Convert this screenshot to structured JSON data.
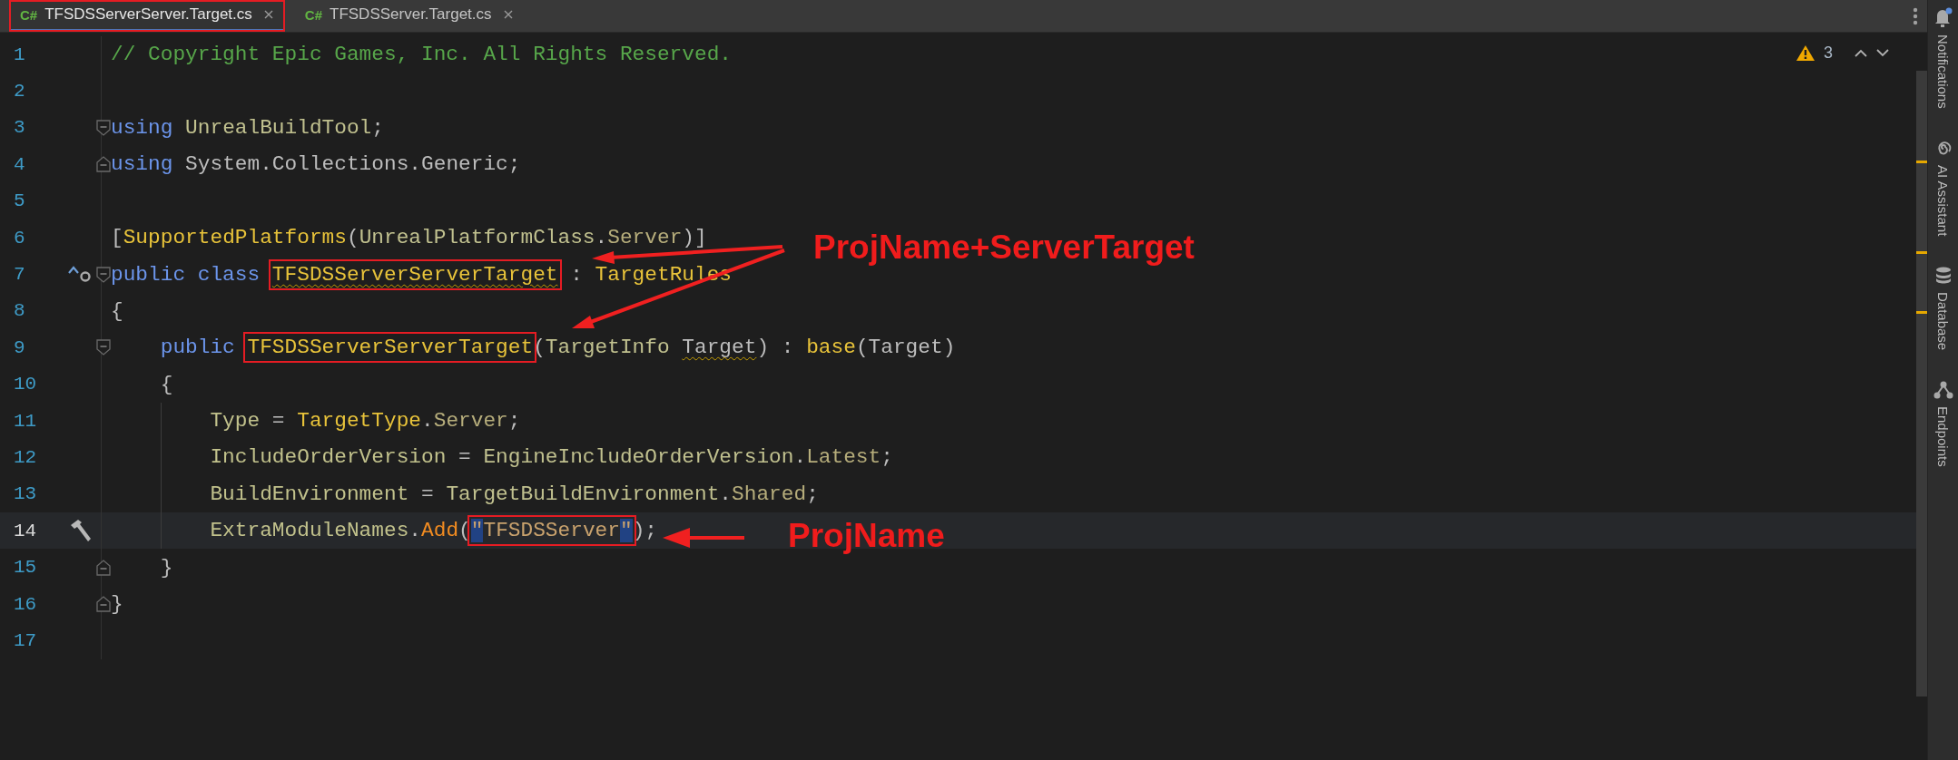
{
  "tabs": [
    {
      "lang": "C#",
      "label": "TFSDSServerServer.Target.cs",
      "selected": true,
      "boxed": true
    },
    {
      "lang": "C#",
      "label": "TFSDSServer.Target.cs",
      "selected": false,
      "boxed": false
    }
  ],
  "editor": {
    "warning_count": "3",
    "lines": [
      {
        "number": "1",
        "current": false,
        "tokens": [
          {
            "kind": "comment",
            "text": "// Copyright Epic Games, Inc. All Rights Reserved."
          }
        ]
      },
      {
        "number": "2",
        "current": false
      },
      {
        "number": "3",
        "current": false,
        "fold": {
          "kind": "open"
        },
        "tokens": [
          {
            "kind": "kw",
            "text": "using "
          },
          {
            "kind": "type",
            "text": "UnrealBuildTool"
          },
          {
            "kind": "plain",
            "text": ";"
          }
        ]
      },
      {
        "number": "4",
        "current": false,
        "fold": {
          "kind": "close"
        },
        "tokens": [
          {
            "kind": "kw",
            "text": "using "
          },
          {
            "kind": "plain",
            "text": "System.Collections.Generic;"
          }
        ]
      },
      {
        "number": "5",
        "current": false
      },
      {
        "number": "6",
        "current": false,
        "tokens": [
          {
            "kind": "plain",
            "text": "["
          },
          {
            "kind": "cls",
            "text": "SupportedPlatforms"
          },
          {
            "kind": "plain",
            "text": "("
          },
          {
            "kind": "type",
            "text": "UnrealPlatformClass"
          },
          {
            "kind": "plain",
            "text": "."
          },
          {
            "kind": "member",
            "text": "Server"
          },
          {
            "kind": "plain",
            "text": ")]"
          }
        ]
      },
      {
        "number": "7",
        "current": false,
        "gutter_icon": {
          "kind": "override"
        },
        "fold": {
          "kind": "open"
        },
        "tokens": [
          {
            "kind": "kw",
            "text": "public class "
          },
          {
            "kind": "cls",
            "text": "TFSDSServerServerTarget",
            "squiggle": true,
            "boxed": true
          },
          {
            "kind": "plain",
            "text": " : "
          },
          {
            "kind": "cls",
            "text": "TargetRules"
          }
        ]
      },
      {
        "number": "8",
        "current": false,
        "tokens": [
          {
            "kind": "plain",
            "text": "{"
          }
        ]
      },
      {
        "number": "9",
        "current": false,
        "fold": {
          "kind": "open"
        },
        "tokens": [
          {
            "kind": "kw",
            "text": "    public "
          },
          {
            "kind": "cls",
            "text": "TFSDSServerServerTarget",
            "boxed": true
          },
          {
            "kind": "plain",
            "text": "("
          },
          {
            "kind": "type",
            "text": "TargetInfo "
          },
          {
            "kind": "param",
            "text": "Target",
            "squiggle": true
          },
          {
            "kind": "plain",
            "text": ") : "
          },
          {
            "kind": "cls",
            "text": "base"
          },
          {
            "kind": "plain",
            "text": "("
          },
          {
            "kind": "param",
            "text": "Target"
          },
          {
            "kind": "plain",
            "text": ")"
          }
        ]
      },
      {
        "number": "10",
        "current": false,
        "tokens": [
          {
            "kind": "plain",
            "text": "    {"
          }
        ]
      },
      {
        "number": "11",
        "current": false,
        "indent_guide": true,
        "tokens": [
          {
            "kind": "prop",
            "text": "        Type"
          },
          {
            "kind": "plain",
            "text": " = "
          },
          {
            "kind": "cls",
            "text": "TargetType"
          },
          {
            "kind": "plain",
            "text": "."
          },
          {
            "kind": "member",
            "text": "Server"
          },
          {
            "kind": "plain",
            "text": ";"
          }
        ]
      },
      {
        "number": "12",
        "current": false,
        "indent_guide": true,
        "tokens": [
          {
            "kind": "prop",
            "text": "        IncludeOrderVersion"
          },
          {
            "kind": "plain",
            "text": " = "
          },
          {
            "kind": "type",
            "text": "EngineIncludeOrderVersion"
          },
          {
            "kind": "plain",
            "text": "."
          },
          {
            "kind": "member",
            "text": "Latest"
          },
          {
            "kind": "plain",
            "text": ";"
          }
        ]
      },
      {
        "number": "13",
        "current": false,
        "indent_guide": true,
        "tokens": [
          {
            "kind": "prop",
            "text": "        BuildEnvironment"
          },
          {
            "kind": "plain",
            "text": " = "
          },
          {
            "kind": "type",
            "text": "TargetBuildEnvironment"
          },
          {
            "kind": "plain",
            "text": "."
          },
          {
            "kind": "member",
            "text": "Shared"
          },
          {
            "kind": "plain",
            "text": ";"
          }
        ]
      },
      {
        "number": "14",
        "current": true,
        "gutter_icon": {
          "kind": "build"
        },
        "indent_guide": true,
        "tokens": [
          {
            "kind": "prop",
            "text": "        ExtraModuleNames"
          },
          {
            "kind": "plain",
            "text": "."
          },
          {
            "kind": "method",
            "text": "Add"
          },
          {
            "kind": "plain",
            "text": "("
          },
          {
            "kind": "group",
            "boxed": true,
            "tokens": [
              {
                "kind": "str",
                "text": "\"",
                "selected": true
              },
              {
                "kind": "str",
                "text": "TFSDSServer"
              },
              {
                "kind": "str",
                "text": "\"",
                "selected": true
              }
            ]
          },
          {
            "kind": "plain",
            "text": ");"
          }
        ]
      },
      {
        "number": "15",
        "current": false,
        "fold": {
          "kind": "close"
        },
        "tokens": [
          {
            "kind": "plain",
            "text": "    }"
          }
        ]
      },
      {
        "number": "16",
        "current": false,
        "fold": {
          "kind": "close"
        },
        "tokens": [
          {
            "kind": "plain",
            "text": "}"
          }
        ]
      },
      {
        "number": "17",
        "current": false
      }
    ]
  },
  "tool_window_bar": [
    {
      "kind": "bell",
      "label": "Notifications"
    },
    {
      "kind": "spiral",
      "label": "AI Assistant"
    },
    {
      "kind": "database",
      "label": "Database"
    },
    {
      "kind": "endpoints",
      "label": "Endpoints"
    }
  ],
  "annotations": [
    {
      "kind": "two_arrows",
      "label": "ProjName+ServerTarget"
    },
    {
      "kind": "one_arrow",
      "label": "ProjName"
    }
  ]
}
